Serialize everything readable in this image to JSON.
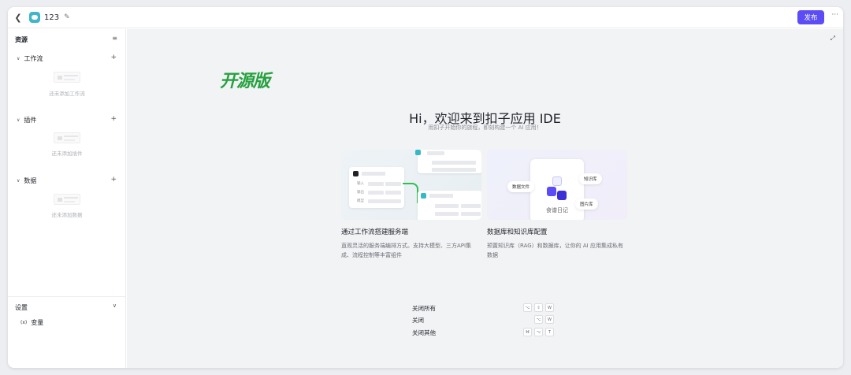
{
  "header": {
    "back_icon": "chevron-left-icon",
    "app_title": "123",
    "edit_icon": "edit-icon",
    "publish_label": "发布",
    "more_icon": "more-icon",
    "accent": "#5b4cf5"
  },
  "sidebar": {
    "title": "资源",
    "sections": [
      {
        "label": "工作流",
        "empty": "还未添加工作流"
      },
      {
        "label": "插件",
        "empty": "还未添加插件"
      },
      {
        "label": "数据",
        "empty": "还未添加数据"
      }
    ],
    "settings": {
      "title": "设置",
      "variable_prefix": "(x)",
      "variable_label": "变量"
    }
  },
  "main": {
    "logo_text": "开源版",
    "logo_color": "#26a13f",
    "heading": "Hi，欢迎来到扣子应用 IDE",
    "subheading": "用扣子开始你的旅程，即刻构建一个 AI 应用！",
    "cards": [
      {
        "title": "通过工作流搭建服务端",
        "desc": "直观灵活的服务端编排方式。支持大模型、三方API集成、流程控制等丰富组件"
      },
      {
        "title": "数据库和知识库配置",
        "desc": "预置知识库（RAG）和数据库，让你的 AI 应用集成私有数据"
      }
    ],
    "card2_pills": [
      "数据文件",
      "知识库",
      "图片库"
    ],
    "card2_phone_label": "食谱日记",
    "card1_mock_labels": [
      "输入",
      "输出",
      "模型"
    ],
    "shortcuts": [
      {
        "label": "关闭所有",
        "keys": [
          "⌥",
          "⇧",
          "W"
        ]
      },
      {
        "label": "关闭",
        "keys": [
          "⌥",
          "W"
        ]
      },
      {
        "label": "关闭其他",
        "keys": [
          "⌘",
          "⌥",
          "T"
        ]
      }
    ]
  }
}
